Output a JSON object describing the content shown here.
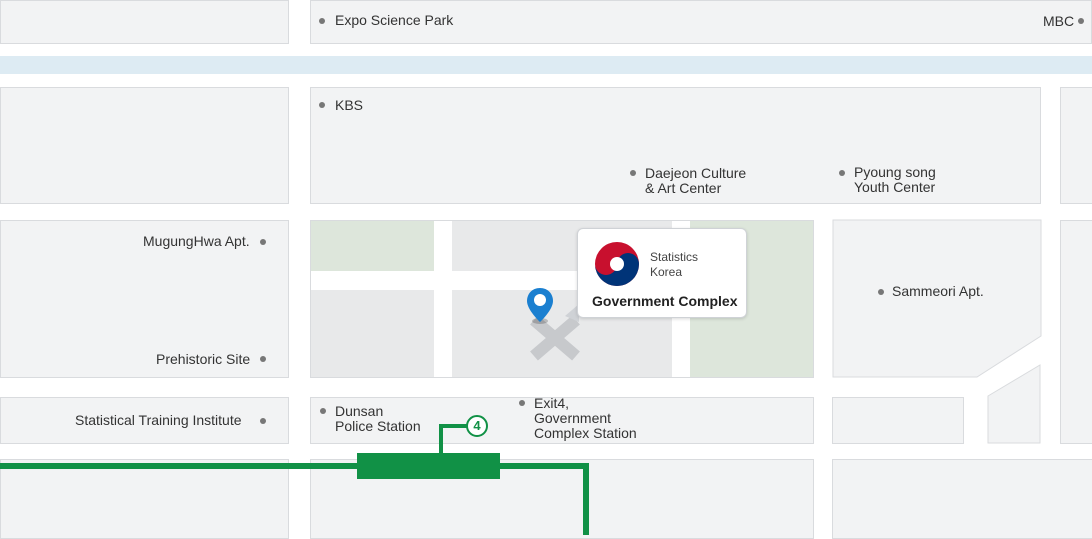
{
  "places": {
    "expo_science_park": "Expo Science Park",
    "mbc": "MBC",
    "kbs": "KBS",
    "daejeon_culture_line1": "Daejeon Culture",
    "daejeon_culture_line2": "& Art Center",
    "pyoung_song_line1": "Pyoung song",
    "pyoung_song_line2": "Youth Center",
    "mugunghwa_apt": "MugungHwa Apt.",
    "prehistoric_site": "Prehistoric Site",
    "sammeori_apt": "Sammeori Apt.",
    "statistical_training_institute": "Statistical Training Institute",
    "dunsan_line1": "Dunsan",
    "dunsan_line2": "Police Station",
    "exit4_line1": "Exit4,",
    "exit4_line2": "Government",
    "exit4_line3": "Complex Station"
  },
  "callout": {
    "logo_line1": "Statistics",
    "logo_line2": "Korea",
    "title": "Government Complex"
  },
  "subway": {
    "line_number": "4",
    "line_color": "#119146"
  },
  "colors": {
    "block": "#f2f3f4",
    "green_area": "#dde6db",
    "river": "#ddebf3",
    "pin": "#1a7fd0"
  },
  "icons": {
    "pin": "location-pin-icon",
    "marker": "x-marker-icon",
    "logo": "taegeuk-logo-icon"
  }
}
